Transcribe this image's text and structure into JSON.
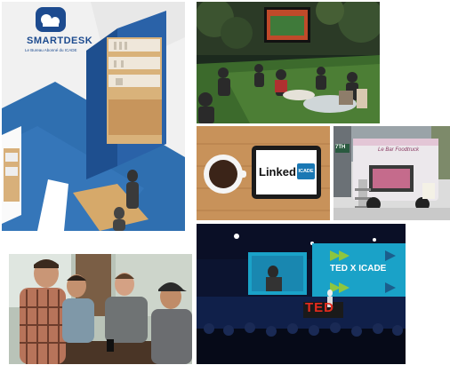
{
  "collage": {
    "smartdesk": {
      "brand_name": "SMARTDESK",
      "tagline": "Le Bureau Abonné du ICADE"
    },
    "linkedin": {
      "logo_word": "Linked",
      "logo_badge": "ICADE"
    },
    "ted": {
      "screen_title": "TED X ICADE",
      "stage_logo": "TED"
    },
    "food_truck": {
      "truck_lettering": "Le Bar Foodtruck",
      "street_sign": "7TH"
    }
  },
  "colors": {
    "smartdesk_blue": "#1d4b8f",
    "floor_blue": "#2f6fb0",
    "linkedin_blue": "#1a78b4",
    "ted_red": "#e62b1e",
    "ted_screen": "#1aa2c8",
    "ted_arrow_green": "#8dc63f"
  }
}
